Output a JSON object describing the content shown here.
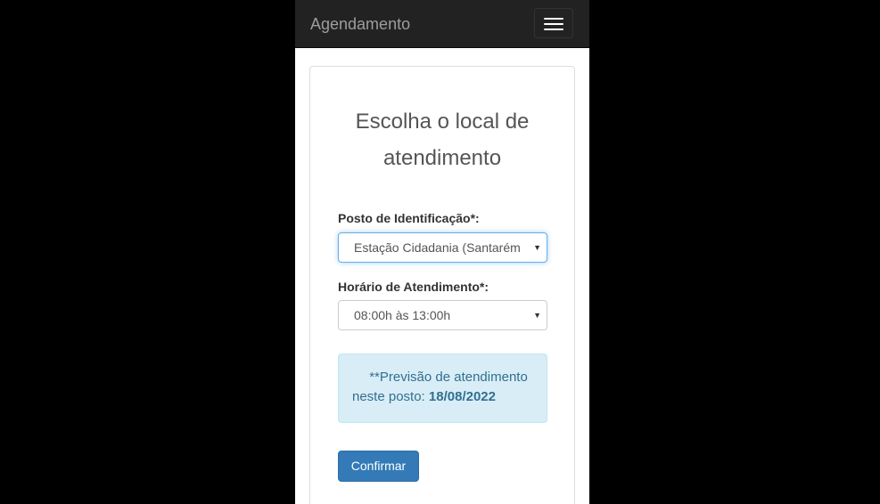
{
  "navbar": {
    "brand": "Agendamento"
  },
  "form": {
    "title": "Escolha o local de atendimento",
    "posto_label": "Posto de Identificação*:",
    "posto_value": "Estação Cidadania (Santarém",
    "horario_label": "Horário de Atendimento*:",
    "horario_value": "08:00h às 13:00h",
    "alert_prefix": "**Previsão de atendimento",
    "alert_middle": "neste posto: ",
    "alert_date": "18/08/2022",
    "confirm_label": "Confirmar"
  },
  "colors": {
    "navbar_bg": "#222222",
    "primary": "#337ab7",
    "alert_bg": "#d9edf7",
    "alert_text": "#31708f",
    "focus_border": "#66afe9"
  },
  "icons": {
    "menu": "hamburger-icon",
    "select_arrow": "caret-down-icon"
  }
}
